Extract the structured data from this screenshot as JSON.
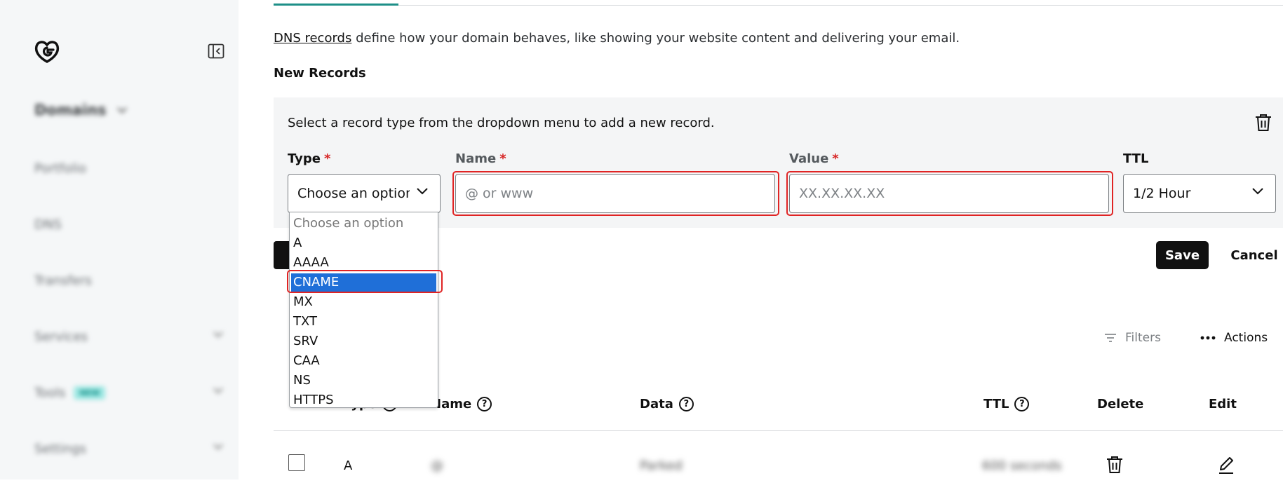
{
  "sidebar": {
    "items": [
      {
        "label": "Domains"
      },
      {
        "label": "Portfolio"
      },
      {
        "label": "DNS"
      },
      {
        "label": "Transfers"
      },
      {
        "label": "Services"
      },
      {
        "label": "Tools",
        "badge": "NEW"
      },
      {
        "label": "Settings"
      }
    ]
  },
  "intro": {
    "link": "DNS records",
    "text": " define how your domain behaves, like showing your website content and delivering your email."
  },
  "new_records": {
    "title": "New Records",
    "message": "Select a record type from the dropdown menu to add a new record.",
    "type_label": "Type",
    "name_label": "Name",
    "value_label": "Value",
    "ttl_label": "TTL",
    "required_marker": "*",
    "type_value": "Choose an option",
    "name_placeholder": "@ or www",
    "value_placeholder": "XX.XX.XX.XX",
    "ttl_value": "1/2 Hour",
    "save": "Save",
    "cancel": "Cancel"
  },
  "dropdown": {
    "options": [
      "Choose an option",
      "A",
      "AAAA",
      "CNAME",
      "MX",
      "TXT",
      "SRV",
      "CAA",
      "NS",
      "HTTPS"
    ],
    "selected": "CNAME"
  },
  "toolbar": {
    "filters": "Filters",
    "actions": "Actions"
  },
  "table": {
    "headers": {
      "type": "Type",
      "name": "Name",
      "data": "Data",
      "ttl": "TTL",
      "delete": "Delete",
      "edit": "Edit"
    },
    "rows": [
      {
        "type": "A",
        "name": "@",
        "data": "Parked",
        "ttl": "600 seconds"
      }
    ]
  },
  "colors": {
    "accent": "#1e8f88",
    "selected": "#1f6fd8",
    "required": "#d72525",
    "highlight": "#e02424"
  }
}
